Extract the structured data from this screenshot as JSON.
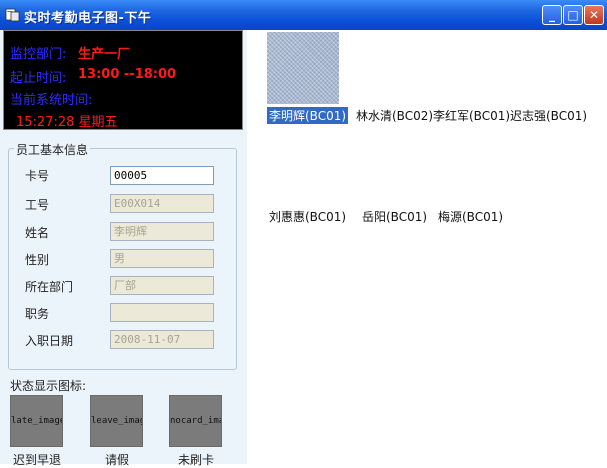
{
  "window": {
    "title": "实时考勤电子图-下午",
    "buttons": {
      "minimize": "_",
      "maximize": "□",
      "close": "✕"
    }
  },
  "led": {
    "dept_label": "监控部门:",
    "dept_value": "生产一厂",
    "time_label": "起止时间:",
    "time_value": "13:00 --18:00",
    "system_time_label": "当前系统时间:",
    "current_time": "15:27:28 星期五"
  },
  "employee_info": {
    "legend": "员工基本信息",
    "fields": [
      {
        "label": "卡号",
        "value": "00005"
      },
      {
        "label": "工号",
        "value": "E00X014"
      },
      {
        "label": "姓名",
        "value": "李明辉"
      },
      {
        "label": "性别",
        "value": "男"
      },
      {
        "label": "所在部门",
        "value": "厂部"
      },
      {
        "label": "职务",
        "value": ""
      },
      {
        "label": "入职日期",
        "value": "2008-11-07"
      }
    ]
  },
  "status_icons": {
    "title": "状态显示图标:",
    "items": [
      {
        "image_text": "late_image",
        "caption": "迟到早退"
      },
      {
        "image_text": "leave_image",
        "caption": "请假"
      },
      {
        "image_text": "nocard_image",
        "caption": "未刷卡"
      }
    ]
  },
  "employees": [
    {
      "name": "李明辉(BC01)",
      "selected": true
    },
    {
      "name": "林水清(BC02)",
      "selected": false
    },
    {
      "name": "李红军(BC01)",
      "selected": false
    },
    {
      "name": "迟志强(BC01)",
      "selected": false
    },
    {
      "name": "刘惠惠(BC01)",
      "selected": false
    },
    {
      "name": "岳阳(BC01)",
      "selected": false
    },
    {
      "name": "梅源(BC01)",
      "selected": false
    }
  ]
}
